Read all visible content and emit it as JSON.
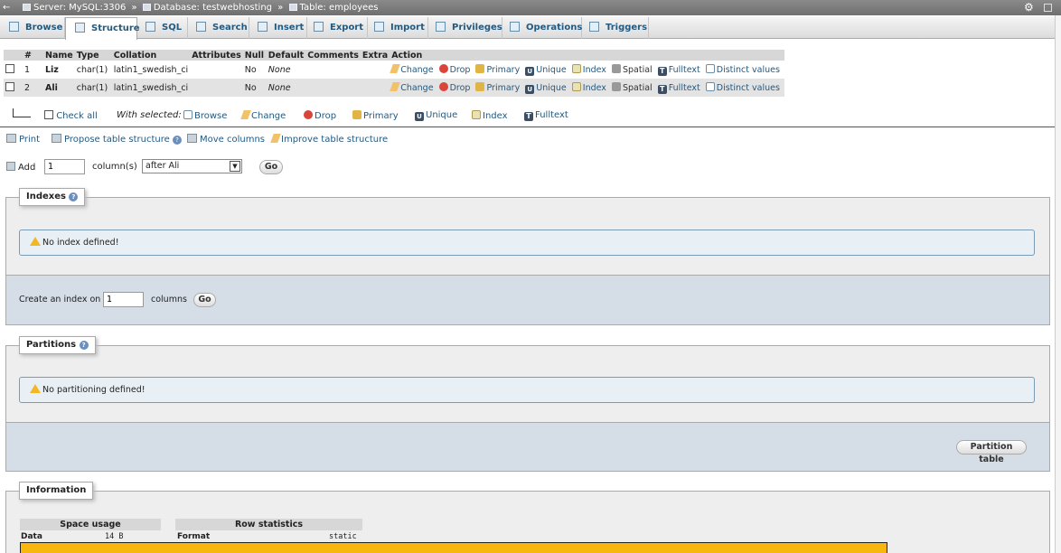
{
  "breadcrumb": {
    "back": "←",
    "server": "Server: MySQL:3306",
    "database": "Database: testwebhosting",
    "table": "Table: employees",
    "sep": "»"
  },
  "tabs": [
    {
      "label": "Browse",
      "icon": "browse-icon"
    },
    {
      "label": "Structure",
      "icon": "structure-icon"
    },
    {
      "label": "SQL",
      "icon": "sql-icon"
    },
    {
      "label": "Search",
      "icon": "search-icon"
    },
    {
      "label": "Insert",
      "icon": "insert-icon"
    },
    {
      "label": "Export",
      "icon": "export-icon"
    },
    {
      "label": "Import",
      "icon": "import-icon"
    },
    {
      "label": "Privileges",
      "icon": "privileges-icon"
    },
    {
      "label": "Operations",
      "icon": "operations-icon"
    },
    {
      "label": "Triggers",
      "icon": "triggers-icon"
    }
  ],
  "columns_table": {
    "headers": [
      "#",
      "Name",
      "Type",
      "Collation",
      "Attributes",
      "Null",
      "Default",
      "Comments",
      "Extra",
      "Action"
    ],
    "rows": [
      {
        "num": "1",
        "name": "Liz",
        "type": "char(1)",
        "collation": "latin1_swedish_ci",
        "attributes": "",
        "null": "No",
        "default": "None",
        "comments": "",
        "extra": ""
      },
      {
        "num": "2",
        "name": "Ali",
        "type": "char(1)",
        "collation": "latin1_swedish_ci",
        "attributes": "",
        "null": "No",
        "default": "None",
        "comments": "",
        "extra": ""
      }
    ],
    "actions": [
      "Change",
      "Drop",
      "Primary",
      "Unique",
      "Index",
      "Spatial",
      "Fulltext",
      "Distinct values"
    ]
  },
  "with_selected": {
    "check_all": "Check all",
    "label": "With selected:",
    "actions": [
      "Browse",
      "Change",
      "Drop",
      "Primary",
      "Unique",
      "Index",
      "Fulltext"
    ]
  },
  "tools": {
    "print": "Print",
    "propose": "Propose table structure",
    "move": "Move columns",
    "improve": "Improve table structure"
  },
  "add_columns": {
    "label": "Add",
    "count": "1",
    "unit": "column(s)",
    "position": "after Ali",
    "go": "Go"
  },
  "indexes": {
    "legend": "Indexes",
    "notice": "No index defined!",
    "create_label": "Create an index on",
    "create_count": "1",
    "create_unit": "columns",
    "go": "Go"
  },
  "partitions": {
    "legend": "Partitions",
    "notice": "No partitioning defined!",
    "button": "Partition table"
  },
  "information": {
    "legend": "Information",
    "space_usage": "Space usage",
    "row_statistics": "Row statistics",
    "data_label": "Data",
    "data_value": "14 B",
    "format_label": "Format",
    "format_value": "static"
  }
}
